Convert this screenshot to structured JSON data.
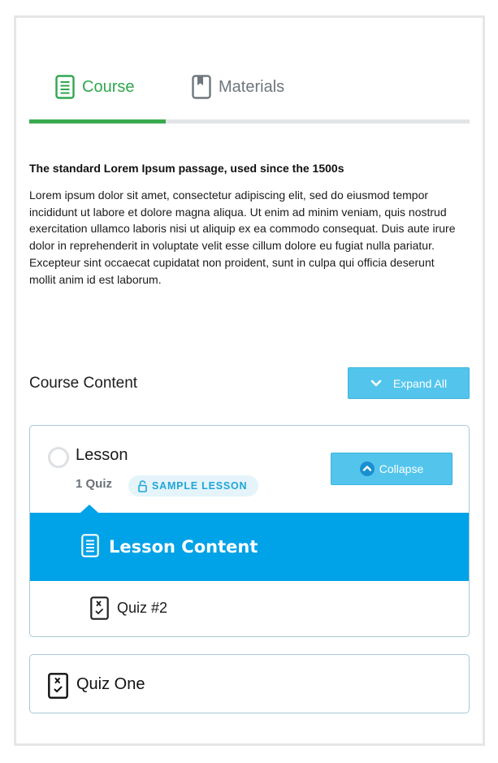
{
  "tabs": {
    "course": {
      "label": "Course",
      "icon": "document-icon"
    },
    "materials": {
      "label": "Materials",
      "icon": "bookmark-book-icon"
    },
    "progress_fraction": 0.31
  },
  "intro": {
    "title": "The standard Lorem Ipsum passage, used since the 1500s",
    "body": "Lorem ipsum dolor sit amet, consectetur adipiscing elit, sed do eiusmod tempor incididunt ut labore et dolore magna aliqua. Ut enim ad minim veniam, quis nostrud exercitation ullamco laboris nisi ut aliquip ex ea commodo consequat. Duis aute irure dolor in reprehenderit in voluptate velit esse cillum dolore eu fugiat nulla pariatur. Excepteur sint occaecat cupidatat non proident, sunt in culpa qui officia deserunt mollit anim id est laborum."
  },
  "course_content": {
    "heading": "Course Content",
    "expand_all_label": "Expand All",
    "lesson": {
      "title": "Lesson",
      "meta": "1 Quiz",
      "badge": "SAMPLE LESSON",
      "collapse_label": "Collapse",
      "items": [
        {
          "label": "Lesson Content",
          "icon": "document-icon"
        },
        {
          "label": "Quiz #2",
          "icon": "quiz-icon"
        }
      ]
    },
    "quiz": {
      "label": "Quiz One",
      "icon": "quiz-icon"
    }
  },
  "colors": {
    "accent_green": "#2fa84f",
    "accent_blue": "#00a2e8",
    "button_blue": "#53c5ec"
  }
}
